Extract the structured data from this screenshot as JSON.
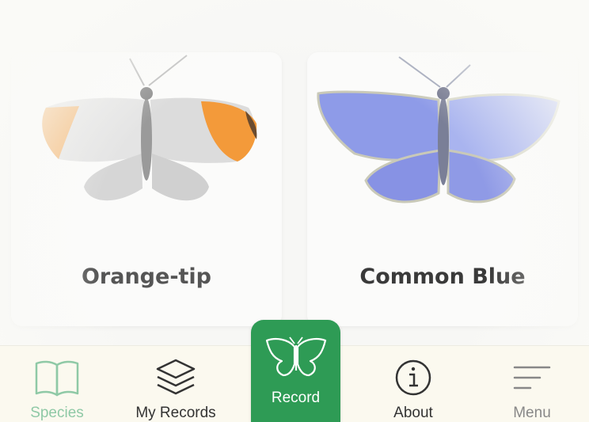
{
  "species_cards": [
    {
      "name": "Orange-tip"
    },
    {
      "name": "Common Blue"
    }
  ],
  "tabbar": {
    "species": {
      "label": "Species",
      "icon": "book-icon"
    },
    "records": {
      "label": "My Records",
      "icon": "layers-icon"
    },
    "record": {
      "label": "Record",
      "icon": "butterfly-icon"
    },
    "about": {
      "label": "About",
      "icon": "info-icon"
    },
    "menu": {
      "label": "Menu",
      "icon": "menu-icon"
    }
  },
  "colors": {
    "accent": "#2e9b55",
    "active_tab": "#8fc9a6",
    "tabbar_bg": "#fbf9ef"
  }
}
